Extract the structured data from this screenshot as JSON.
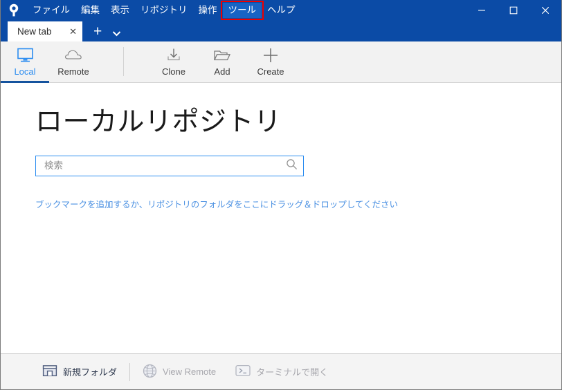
{
  "window": {
    "logo_icon": "sourcetree-logo-icon",
    "controls": {
      "minimize": "—",
      "maximize": "☐",
      "close": "✕"
    }
  },
  "menubar": {
    "items": [
      {
        "label": "ファイル",
        "highlighted": false
      },
      {
        "label": "編集",
        "highlighted": false
      },
      {
        "label": "表示",
        "highlighted": false
      },
      {
        "label": "リポジトリ",
        "highlighted": false
      },
      {
        "label": "操作",
        "highlighted": false
      },
      {
        "label": "ツール",
        "highlighted": true
      },
      {
        "label": "ヘルプ",
        "highlighted": false
      }
    ],
    "highlight_color": "#ee0000"
  },
  "tabstrip": {
    "tabs": [
      {
        "label": "New tab",
        "close_label": "✕",
        "active": true
      }
    ],
    "add_tab_label": "+",
    "tab_menu_icon": "chevron-down-icon"
  },
  "toolbar": {
    "items": [
      {
        "label": "Local",
        "icon": "monitor-icon",
        "active": true
      },
      {
        "label": "Remote",
        "icon": "cloud-icon",
        "active": false
      },
      {
        "label": "Clone",
        "icon": "download-icon",
        "active": false
      },
      {
        "label": "Add",
        "icon": "folder-open-icon",
        "active": false
      },
      {
        "label": "Create",
        "icon": "plus-icon",
        "active": false
      }
    ],
    "active_color": "#2b8cf0",
    "indicator_color": "#15539e"
  },
  "main": {
    "title": "ローカルリポジトリ",
    "search": {
      "placeholder": "検索",
      "value": "",
      "icon": "search-icon",
      "border_color": "#2b8cf0"
    },
    "hint_link": "ブックマークを追加するか、リポジトリのフォルダをここにドラッグ＆ドロップしてください",
    "link_color": "#4a90e2"
  },
  "bottombar": {
    "buttons": [
      {
        "label": "新規フォルダ",
        "icon": "new-folder-icon",
        "disabled": false
      },
      {
        "label": "View Remote",
        "icon": "globe-icon",
        "disabled": true
      },
      {
        "label": "ターミナルで開く",
        "icon": "terminal-icon",
        "disabled": true
      }
    ]
  }
}
